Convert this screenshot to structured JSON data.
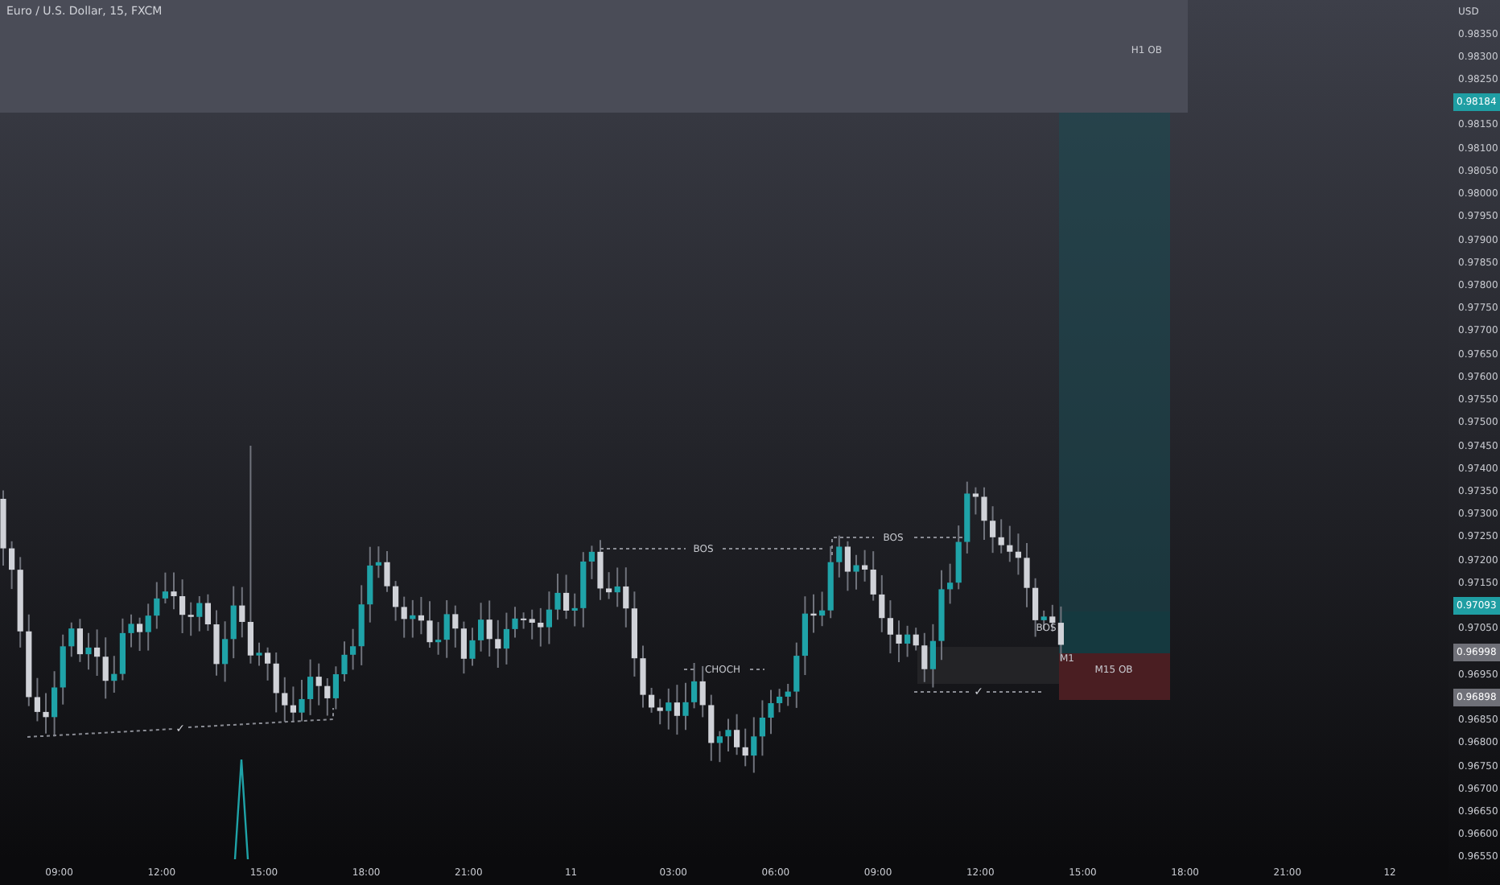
{
  "title": "Euro / U.S. Dollar, 15, FXCM",
  "currency": "USD",
  "price_axis": [
    {
      "kind": "label",
      "text": "0.98350"
    },
    {
      "kind": "label",
      "text": "0.98300"
    },
    {
      "kind": "label",
      "text": "0.98250"
    },
    {
      "kind": "tag",
      "text": "0.98184",
      "color": "#1f9ea3"
    },
    {
      "kind": "label",
      "text": "0.98150"
    },
    {
      "kind": "label",
      "text": "0.98100"
    },
    {
      "kind": "label",
      "text": "0.98050"
    },
    {
      "kind": "label",
      "text": "0.98000"
    },
    {
      "kind": "label",
      "text": "0.97950"
    },
    {
      "kind": "label",
      "text": "0.97900"
    },
    {
      "kind": "label",
      "text": "0.97850"
    },
    {
      "kind": "label",
      "text": "0.97800"
    },
    {
      "kind": "label",
      "text": "0.97750"
    },
    {
      "kind": "label",
      "text": "0.97700"
    },
    {
      "kind": "label",
      "text": "0.97650"
    },
    {
      "kind": "label",
      "text": "0.97600"
    },
    {
      "kind": "label",
      "text": "0.97550"
    },
    {
      "kind": "label",
      "text": "0.97500"
    },
    {
      "kind": "label",
      "text": "0.97450"
    },
    {
      "kind": "label",
      "text": "0.97400"
    },
    {
      "kind": "label",
      "text": "0.97350"
    },
    {
      "kind": "label",
      "text": "0.97300"
    },
    {
      "kind": "label",
      "text": "0.97250"
    },
    {
      "kind": "label",
      "text": "0.97200"
    },
    {
      "kind": "label",
      "text": "0.97150"
    },
    {
      "kind": "tag",
      "text": "0.97093",
      "color": "#1f9ea3"
    },
    {
      "kind": "label",
      "text": "0.97050"
    },
    {
      "kind": "tag",
      "text": "0.96998",
      "color": "#6f7078"
    },
    {
      "kind": "label",
      "text": "0.96950"
    },
    {
      "kind": "tag",
      "text": "0.96898",
      "color": "#6f7078"
    },
    {
      "kind": "label",
      "text": "0.96850"
    },
    {
      "kind": "label",
      "text": "0.96800"
    },
    {
      "kind": "label",
      "text": "0.96750"
    },
    {
      "kind": "label",
      "text": "0.96700"
    },
    {
      "kind": "label",
      "text": "0.96650"
    },
    {
      "kind": "label",
      "text": "0.96600"
    },
    {
      "kind": "label",
      "text": "0.96550"
    }
  ],
  "time_axis": [
    "09:00",
    "12:00",
    "15:00",
    "18:00",
    "21:00",
    "11",
    "03:00",
    "06:00",
    "09:00",
    "12:00",
    "15:00",
    "18:00",
    "21:00",
    "12"
  ],
  "annotations": [
    {
      "kind": "zone",
      "text": "H1 OB"
    },
    {
      "kind": "structure",
      "text": "BOS"
    },
    {
      "kind": "structure",
      "text": "BOS"
    },
    {
      "kind": "structure",
      "text": "CHOCH"
    },
    {
      "kind": "check",
      "text": "✓"
    },
    {
      "kind": "check",
      "text": "✓"
    },
    {
      "kind": "structure",
      "text": "BOS"
    },
    {
      "kind": "structure",
      "text": "M1"
    },
    {
      "kind": "zone",
      "text": "M15 OB"
    }
  ]
}
